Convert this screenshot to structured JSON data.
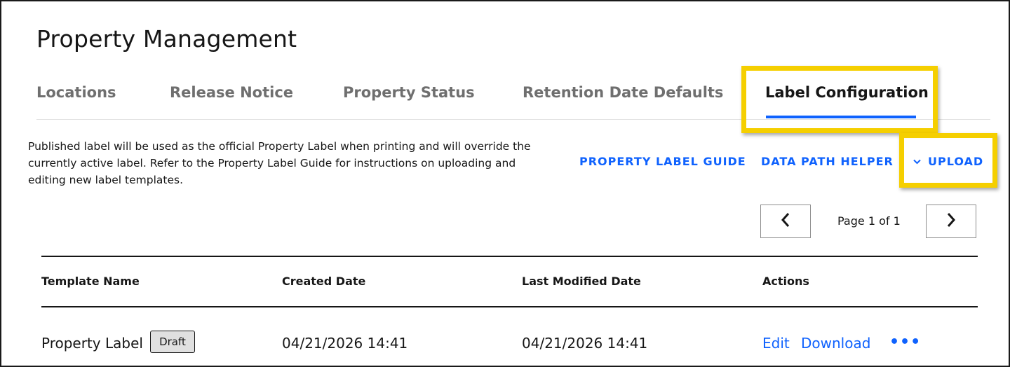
{
  "page": {
    "title": "Property Management"
  },
  "tabs": [
    {
      "label": "Locations"
    },
    {
      "label": "Release Notice"
    },
    {
      "label": "Property Status"
    },
    {
      "label": "Retention Date Defaults"
    },
    {
      "label": "Label Configuration",
      "active": true
    }
  ],
  "description": "Published label will be used as the official Property Label when printing and will override the currently active label. Refer to the Property Label Guide for instructions on uploading and editing new label templates.",
  "actions": {
    "guide": "PROPERTY LABEL GUIDE",
    "helper": "DATA PATH HELPER",
    "upload": "UPLOAD"
  },
  "pagination": {
    "text": "Page 1 of 1"
  },
  "table": {
    "headers": [
      "Template Name",
      "Created Date",
      "Last Modified Date",
      "Actions"
    ],
    "rows": [
      {
        "name": "Property Label",
        "badge": "Draft",
        "created": "04/21/2026 14:41",
        "modified": "04/21/2026 14:41",
        "edit": "Edit",
        "download": "Download",
        "more": "•••"
      }
    ]
  },
  "colors": {
    "accent": "#0f62fe",
    "highlight": "#f5cf00"
  },
  "icons": [
    "chevron-down-icon",
    "chevron-left-icon",
    "chevron-right-icon",
    "overflow-menu-icon"
  ]
}
